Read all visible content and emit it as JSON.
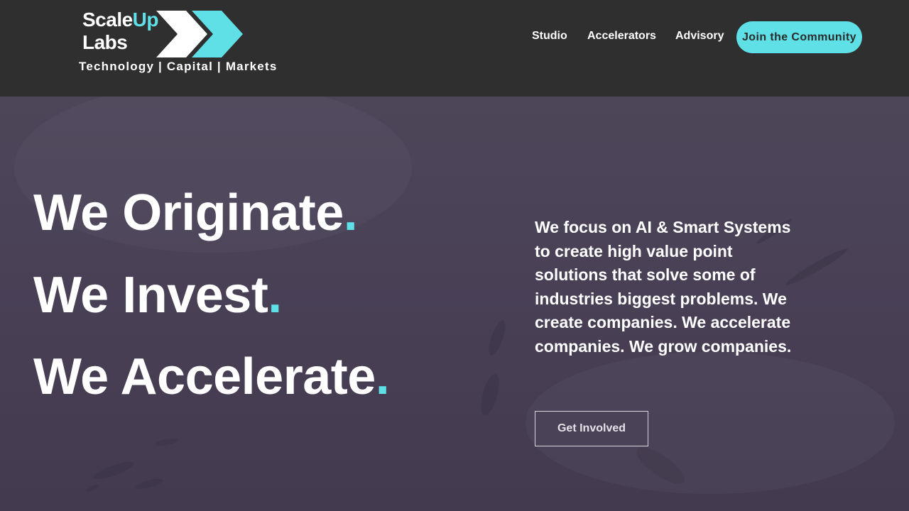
{
  "brand": {
    "name_part1": "Scale",
    "name_part2": "Up",
    "name_line2": "Labs",
    "tagline": "Technology | Capital | Markets",
    "accent_color": "#5ee0e6"
  },
  "nav": {
    "items": [
      {
        "label": "Studio"
      },
      {
        "label": "Accelerators"
      },
      {
        "label": "Advisory"
      }
    ],
    "cta_label": "Join the Community"
  },
  "hero": {
    "headlines": [
      {
        "text": "We Originate",
        "dot": "."
      },
      {
        "text": "We Invest",
        "dot": "."
      },
      {
        "text": "We Accelerate",
        "dot": "."
      }
    ],
    "description": "We focus on AI & Smart Systems to create high value point solutions that solve some of industries biggest problems. We create companies. We accelerate companies. We grow companies.",
    "button_label": "Get Involved"
  }
}
